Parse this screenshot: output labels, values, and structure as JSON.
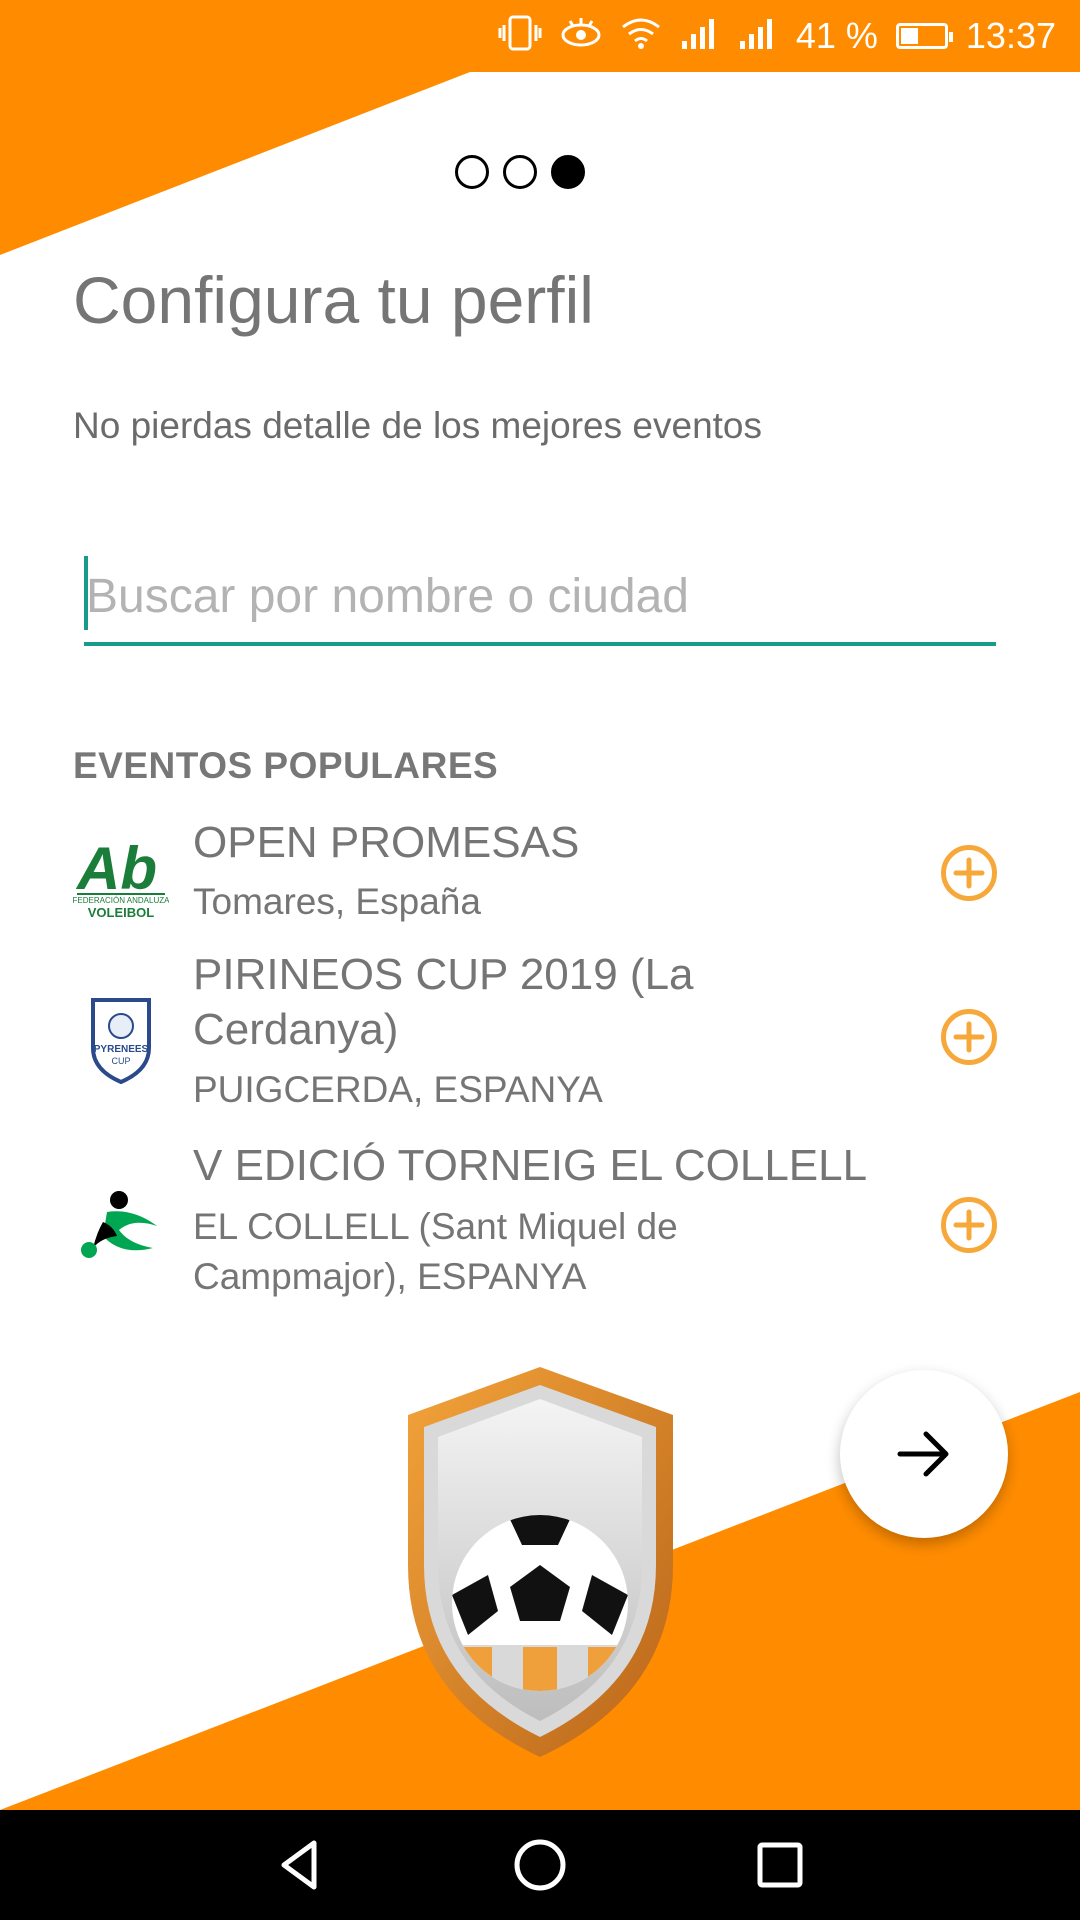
{
  "theme": {
    "accent": "#FF8C00",
    "input_accent": "#1A9A8A",
    "add_color": "#F7A83A"
  },
  "status_bar": {
    "icons": [
      "vibrate-icon",
      "eye-comfort-icon",
      "wifi-icon",
      "signal-icon",
      "signal-icon"
    ],
    "battery_percent": "41 %",
    "battery_level": 0.41,
    "time": "13:37"
  },
  "pager": {
    "total": 3,
    "current": 3
  },
  "header": {
    "title": "Configura tu perfil",
    "subtitle": "No pierdas detalle de los mejores eventos"
  },
  "search": {
    "placeholder": "Buscar por nombre o ciudad",
    "value": ""
  },
  "popular": {
    "header": "EVENTOS POPULARES",
    "events": [
      {
        "name": "OPEN PROMESAS",
        "location": "Tomares, España",
        "logo": "federacion-andaluza-voleibol-logo",
        "logo_text": "FEDERACIÓN ANDALUZA VOLEIBOL"
      },
      {
        "name": "PIRINEOS CUP 2019 (La Cerdanya)",
        "location": "PUIGCERDA, ESPANYA",
        "logo": "pyrenees-cup-logo",
        "logo_text": "PYRENEES CUP"
      },
      {
        "name": "V EDICIÓ TORNEIG EL COLLELL",
        "location": "EL COLLELL (Sant Miquel de Campmajor), ESPANYA",
        "logo": "soccer-player-logo"
      }
    ]
  },
  "icons": {
    "add": "plus-circle-icon",
    "next": "arrow-right-icon",
    "brand": "soccer-shield-logo"
  },
  "nav": {
    "buttons": [
      "back-icon",
      "home-icon",
      "recents-icon"
    ]
  }
}
